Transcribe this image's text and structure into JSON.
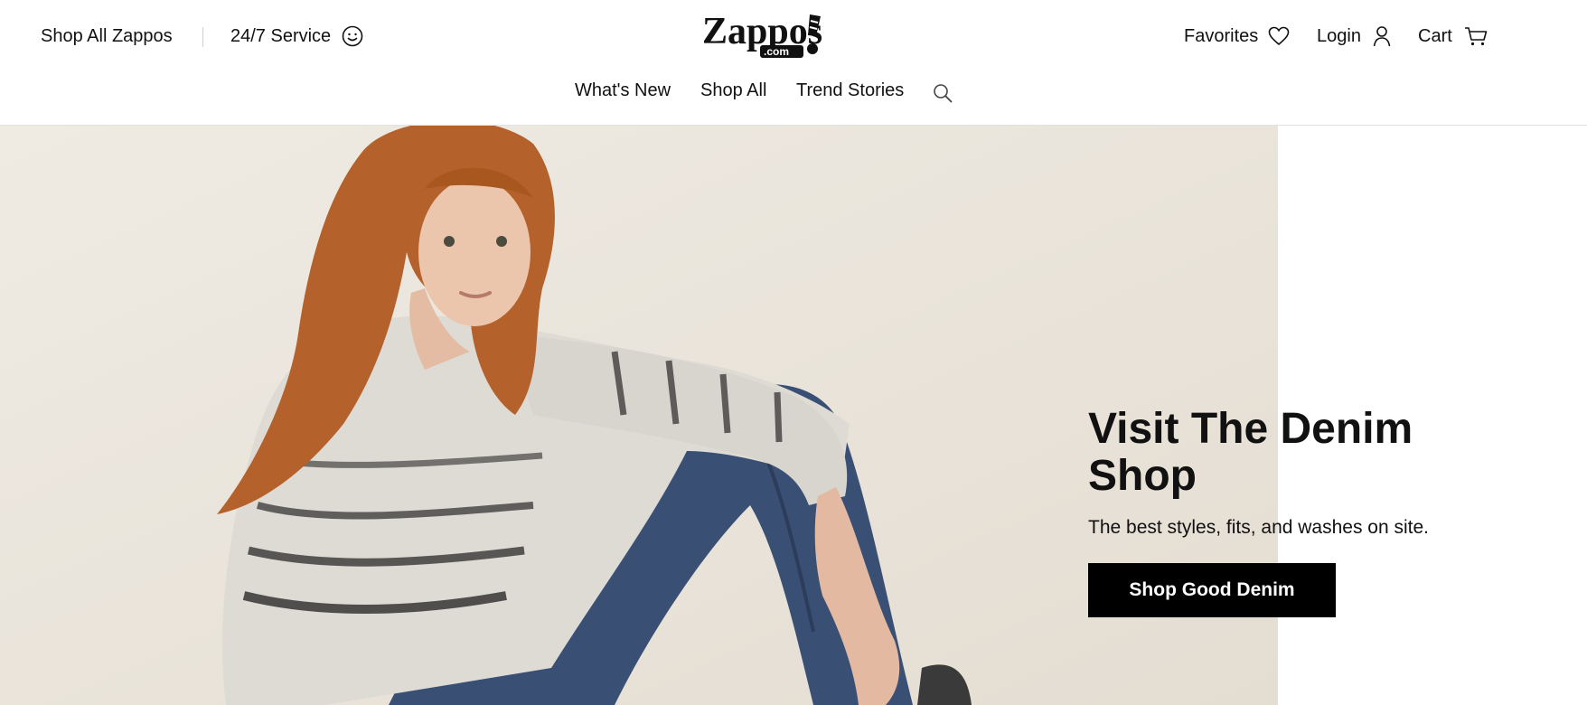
{
  "header": {
    "shop_all_zappos": "Shop All Zappos",
    "service": "24/7 Service",
    "logo_text": "Zappos",
    "logo_suffix": ".com",
    "favorites": "Favorites",
    "login": "Login",
    "cart": "Cart"
  },
  "nav": {
    "items": [
      {
        "label": "What's New"
      },
      {
        "label": "Shop All"
      },
      {
        "label": "Trend Stories"
      }
    ]
  },
  "hero": {
    "headline": "Visit The Denim Shop",
    "subline": "The best styles, fits, and washes on site.",
    "cta": "Shop Good Denim"
  },
  "icons": {
    "service": "smiley-icon",
    "favorites": "heart-icon",
    "login": "user-icon",
    "cart": "cart-icon",
    "search": "search-icon"
  },
  "colors": {
    "cta_bg": "#000000",
    "cta_text": "#ffffff",
    "photo_bg": "#ebe6de"
  }
}
